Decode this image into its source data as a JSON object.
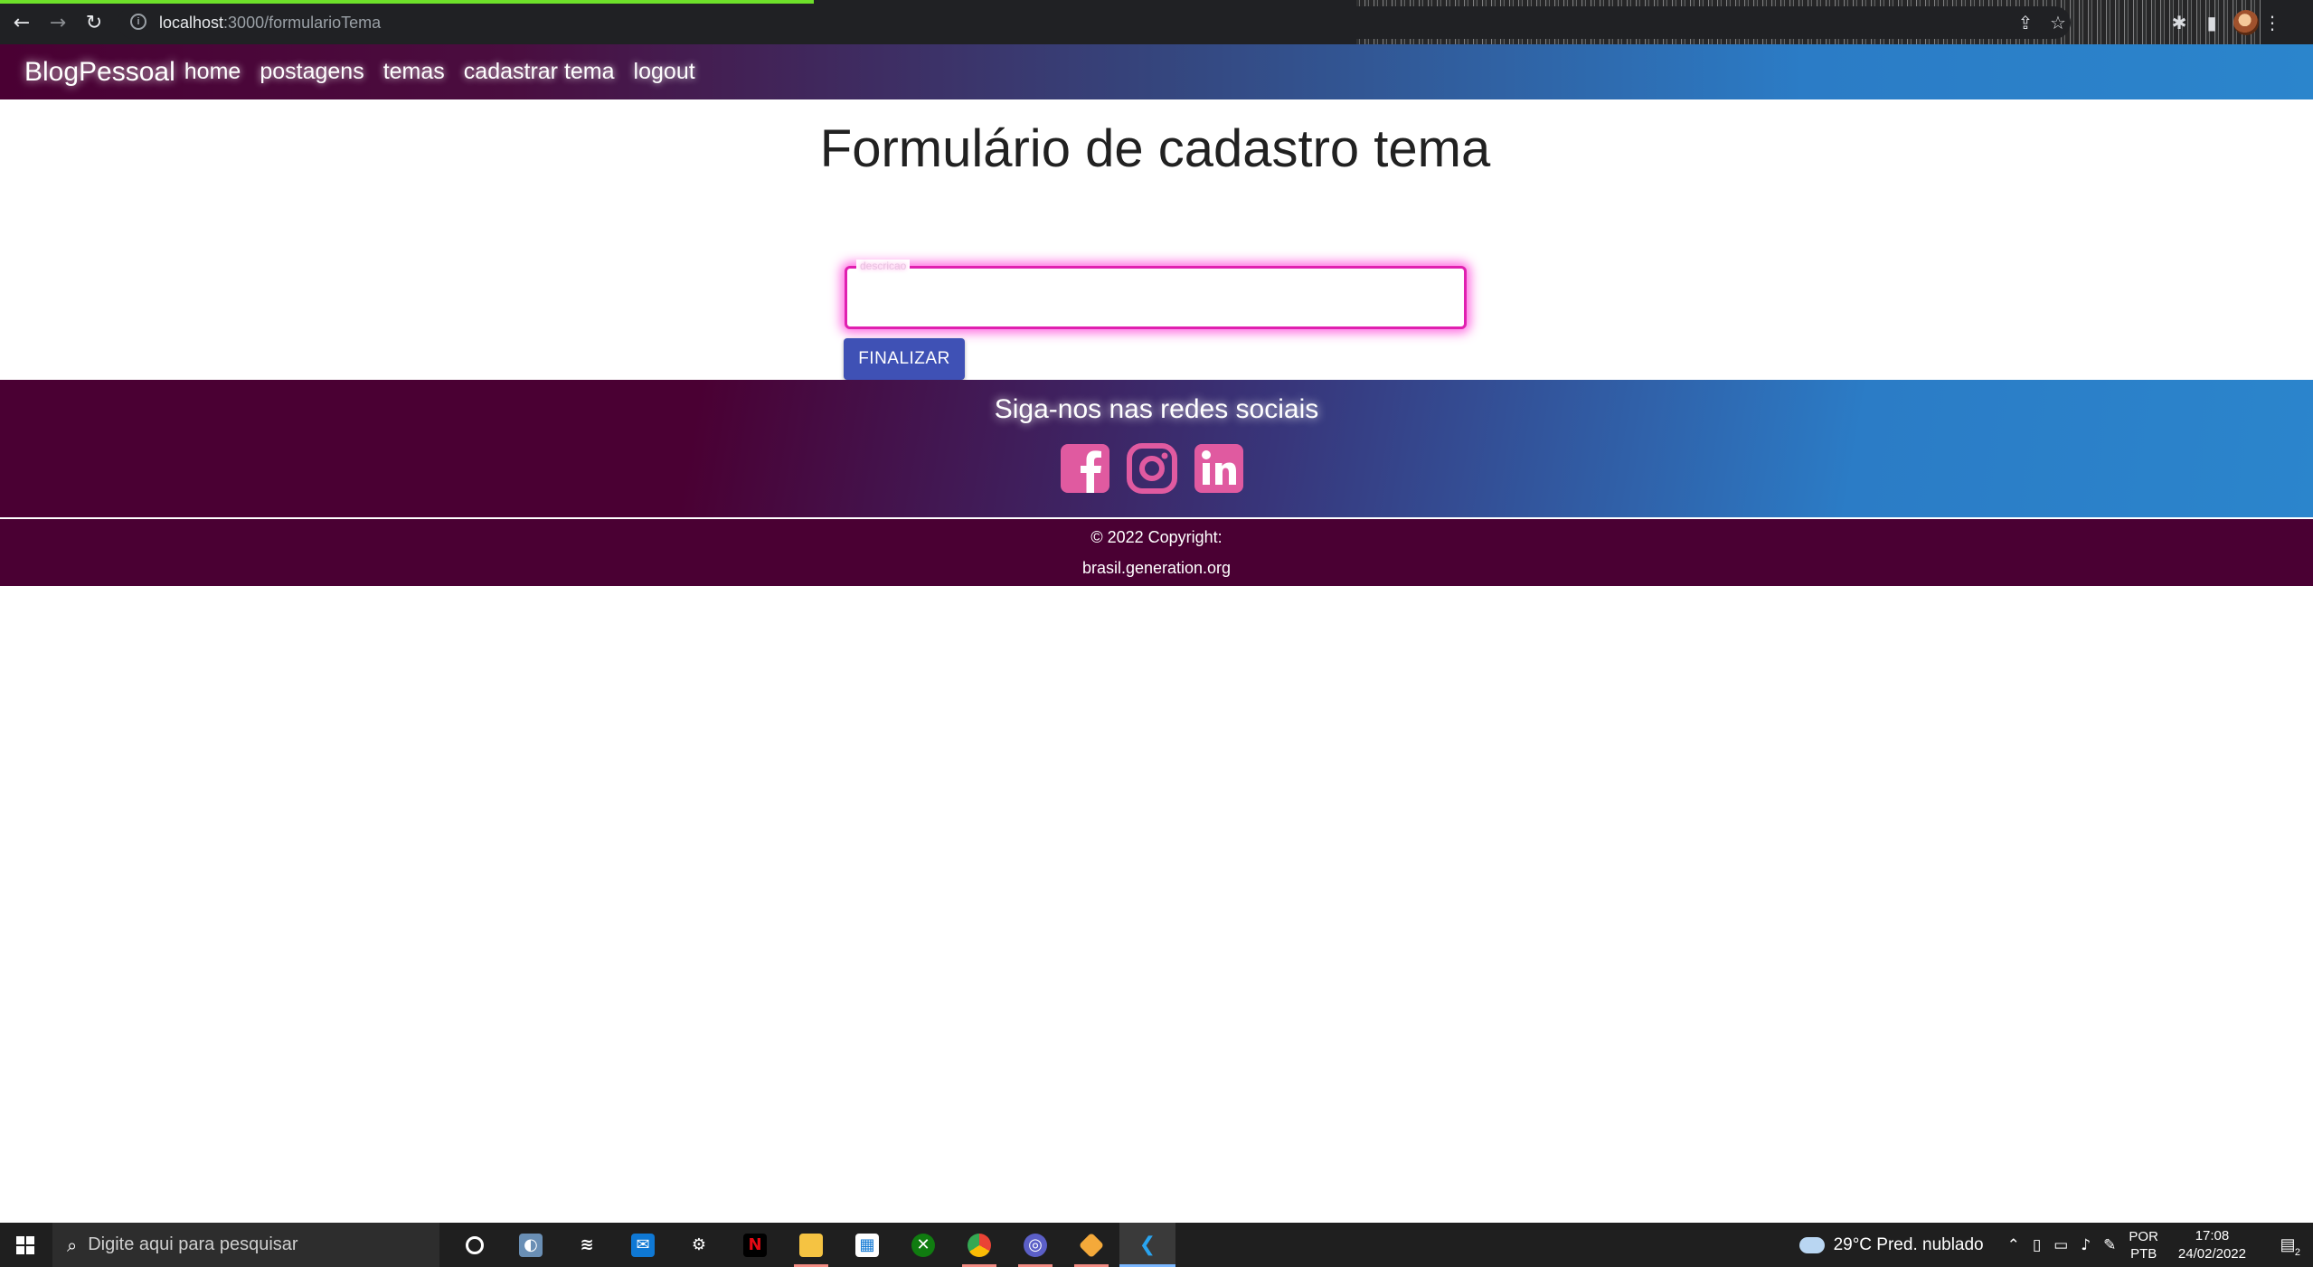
{
  "browser": {
    "url_host": "localhost",
    "url_path": ":3000/formularioTema",
    "icons": [
      "back-arrow-icon",
      "forward-arrow-icon",
      "reload-icon",
      "site-info-icon",
      "share-icon",
      "bookmark-star-icon",
      "extensions-puzzle-icon",
      "side-panel-icon",
      "profile-avatar",
      "menu-kebab-icon"
    ],
    "progress_color": "#6ee02a"
  },
  "navbar": {
    "brand": "BlogPessoal",
    "links": [
      "home",
      "postagens",
      "temas",
      "cadastrar tema",
      "logout"
    ]
  },
  "form": {
    "title": "Formulário de cadastro tema",
    "field_label": "descricao",
    "field_value": "",
    "submit_label": "FINALIZAR",
    "field_border_color": "#e020b0",
    "button_color": "#3f51b5"
  },
  "footer": {
    "social_title": "Siga-nos nas redes sociais",
    "social_icons": [
      "facebook-icon",
      "instagram-icon",
      "linkedin-icon"
    ],
    "social_icon_color": "#e05aa0",
    "copyright": "© 2022 Copyright:",
    "site": "brasil.generation.org"
  },
  "taskbar": {
    "search_placeholder": "Digite aqui para pesquisar",
    "apps": [
      "cortana-icon",
      "photos-icon",
      "stack-icon",
      "mail-icon",
      "settings-icon",
      "netflix-icon",
      "file-explorer-icon",
      "store-icon",
      "xbox-icon",
      "chrome-icon",
      "chrome-canary-icon",
      "git-icon",
      "vscode-icon"
    ],
    "weather": "29°C  Pred. nublado",
    "lang_top": "POR",
    "lang_bottom": "PTB",
    "time": "17:08",
    "date": "24/02/2022",
    "notification_count": "2"
  }
}
